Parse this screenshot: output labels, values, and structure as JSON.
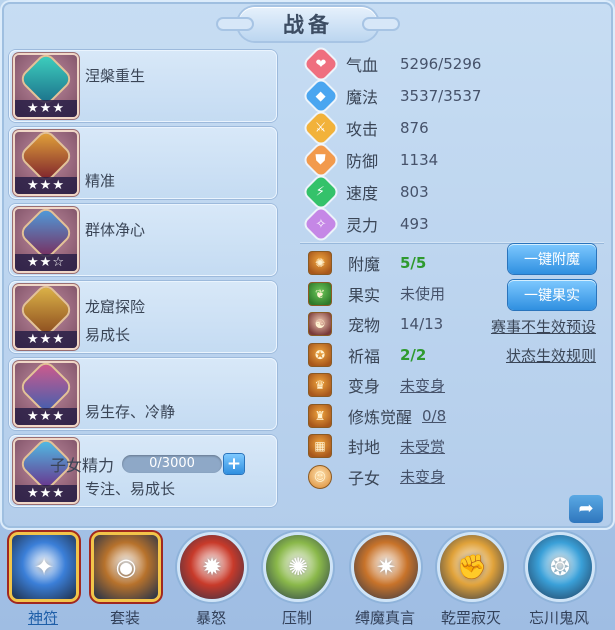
{
  "header": {
    "title": "战备"
  },
  "cards": [
    {
      "line1": "涅槃重生",
      "line2": "",
      "stars": "★★★",
      "colors": [
        "#3fd3c0",
        "#1b6f8a"
      ]
    },
    {
      "line1": "",
      "line2": "精准",
      "stars": "★★★",
      "colors": [
        "#e6a83a",
        "#7a1e2c"
      ]
    },
    {
      "line1": "群体净心",
      "line2": "",
      "stars": "★★☆",
      "colors": [
        "#4da0e0",
        "#7a2a5a"
      ]
    },
    {
      "line1": "龙窟探险",
      "line2": "易成长",
      "stars": "★★★",
      "colors": [
        "#e0b84a",
        "#8a4a1e"
      ]
    },
    {
      "line1": "",
      "line2": "易生存、冷静",
      "stars": "★★★",
      "colors": [
        "#d65a8a",
        "#3e5fb0"
      ]
    },
    {
      "line1": "",
      "line2": "专注、易成长",
      "stars": "★★★",
      "colors": [
        "#4fc2e8",
        "#6a2f8a"
      ]
    }
  ],
  "stats": [
    {
      "label": "气血",
      "value": "5296/5296",
      "icon": "heart-icon",
      "color": "#ef6f7f"
    },
    {
      "label": "魔法",
      "value": "3537/3537",
      "icon": "mana-icon",
      "color": "#4aa6f0"
    },
    {
      "label": "攻击",
      "value": "876",
      "icon": "sword-icon",
      "color": "#f2b23a"
    },
    {
      "label": "防御",
      "value": "1134",
      "icon": "shield-icon",
      "color": "#f29a4c"
    },
    {
      "label": "速度",
      "value": "803",
      "icon": "speed-icon",
      "color": "#34c26a"
    },
    {
      "label": "灵力",
      "value": "493",
      "icon": "spirit-icon",
      "color": "#c587e6"
    }
  ],
  "features": [
    {
      "label": "附魔",
      "value": "5/5",
      "style": "green",
      "icon": "enchant-icon"
    },
    {
      "label": "果实",
      "value": "未使用",
      "style": "",
      "icon": "fruit-icon"
    },
    {
      "label": "宠物",
      "value": "14/13",
      "style": "",
      "icon": "pet-icon"
    },
    {
      "label": "祈福",
      "value": "2/2",
      "style": "green",
      "icon": "blessing-icon"
    },
    {
      "label": "变身",
      "value": "未变身",
      "style": "ul",
      "icon": "transform-icon"
    },
    {
      "label": "修炼觉醒",
      "value": "0/8",
      "style": "ul",
      "icon": "cultivation-icon"
    },
    {
      "label": "封地",
      "value": "未受赏",
      "style": "ul",
      "icon": "fief-icon"
    },
    {
      "label": "子女",
      "value": "未变身",
      "style": "ul",
      "icon": "child-icon"
    }
  ],
  "buttons": {
    "enchant_all": "一键附魔",
    "fruit_all": "一键果实"
  },
  "links": {
    "pet_preset": "赛事不生效预设",
    "blessing_rule": "状态生效规则"
  },
  "energy": {
    "label": "子女精力",
    "value": "0/3000",
    "fraction": 0.0
  },
  "tabs": [
    {
      "label": "神符",
      "style": "square",
      "active": true,
      "color": "#3b7fd8",
      "glyph": "✦"
    },
    {
      "label": "套装",
      "style": "square",
      "active": false,
      "color": "#b7722c",
      "glyph": "◉"
    },
    {
      "label": "暴怒",
      "style": "round",
      "active": false,
      "color": "#c83a2a",
      "glyph": "✹"
    },
    {
      "label": "压制",
      "style": "round",
      "active": false,
      "color": "#8ab84a",
      "glyph": "✺"
    },
    {
      "label": "缚魔真言",
      "style": "round",
      "active": false,
      "color": "#c8732a",
      "glyph": "✷"
    },
    {
      "label": "乾罡寂灭",
      "style": "round",
      "active": false,
      "color": "#e0a23a",
      "glyph": "✊"
    },
    {
      "label": "忘川鬼风",
      "style": "round",
      "active": false,
      "color": "#3aa0d8",
      "glyph": "❂"
    }
  ]
}
